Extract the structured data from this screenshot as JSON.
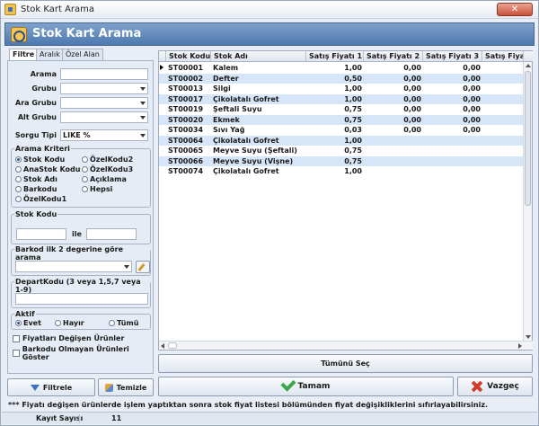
{
  "window": {
    "title": "Stok Kart Arama"
  },
  "banner": {
    "title": "Stok Kart Arama"
  },
  "tabs": [
    "Filtre",
    "Aralık",
    "Özel Alan"
  ],
  "filter": {
    "arama_label": "Arama",
    "grubu_label": "Grubu",
    "ara_grubu_label": "Ara Grubu",
    "alt_grubu_label": "Alt Grubu",
    "sorgu_tipi_label": "Sorgu Tipi",
    "sorgu_tipi_value": "LIKE %"
  },
  "arama_kriteri": {
    "title": "Arama Kriteri",
    "options": [
      "Stok Kodu",
      "ÖzelKodu2",
      "AnaStok Kodu",
      "ÖzelKodu3",
      "Stok Adı",
      "Açıklama",
      "Barkodu",
      "Hepsi",
      "ÖzelKodu1"
    ]
  },
  "stok_kodu": {
    "title": "Stok Kodu",
    "between_label": "ile"
  },
  "barkod": {
    "title": "Barkod ilk 2 degerine göre arama"
  },
  "depart": {
    "title": "DepartKodu (3 veya 1,5,7 veya 1-9)"
  },
  "aktif": {
    "title": "Aktif",
    "options": [
      "Evet",
      "Hayır",
      "Tümü"
    ]
  },
  "checks": [
    "Fiyatları Değişen Ürünler",
    "Barkodu Olmayan Ürünleri Göster"
  ],
  "buttons": {
    "filtrele": "Filtrele",
    "temizle": "Temizle",
    "tumunu_sec": "Tümünü Seç",
    "tamam": "Tamam",
    "vazgec": "Vazgeç"
  },
  "grid": {
    "columns": [
      "Stok Kodu",
      "Stok Adı",
      "Satış Fiyatı 1",
      "Satış Fiyatı 2",
      "Satış Fiyatı 3",
      "Satış Fiyatı"
    ],
    "rows": [
      [
        "ST00001",
        "Kalem",
        "1,00",
        "0,00",
        "0,00"
      ],
      [
        "ST00002",
        "Defter",
        "0,50",
        "0,00",
        "0,00"
      ],
      [
        "ST00013",
        "Silgi",
        "1,00",
        "0,00",
        "0,00"
      ],
      [
        "ST00017",
        "Çikolatalı Gofret",
        "1,00",
        "0,00",
        "0,00"
      ],
      [
        "ST00019",
        "Şeftali Suyu",
        "0,75",
        "0,00",
        "0,00"
      ],
      [
        "ST00020",
        "Ekmek",
        "0,75",
        "0,00",
        "0,00"
      ],
      [
        "ST00034",
        "Sıvı Yağ",
        "0,03",
        "0,00",
        "0,00"
      ],
      [
        "ST00064",
        "Çikolatalı Gofret",
        "1,00",
        "",
        ""
      ],
      [
        "ST00065",
        "Meyve Suyu (Şeftali)",
        "0,75",
        "",
        ""
      ],
      [
        "ST00066",
        "Meyve Suyu (Vişne)",
        "0,75",
        "",
        ""
      ],
      [
        "ST00074",
        "Çikolatalı Gofret",
        "1,00",
        "",
        ""
      ]
    ]
  },
  "footer": {
    "note": "*** Fiyatı değişen ürünlerde işlem yaptıktan sonra stok fiyat listesi bölümünden fiyat değişikliklerini sıfırlayabilirsiniz.",
    "status_label": "Kayıt Sayısı",
    "status_value": "11"
  }
}
